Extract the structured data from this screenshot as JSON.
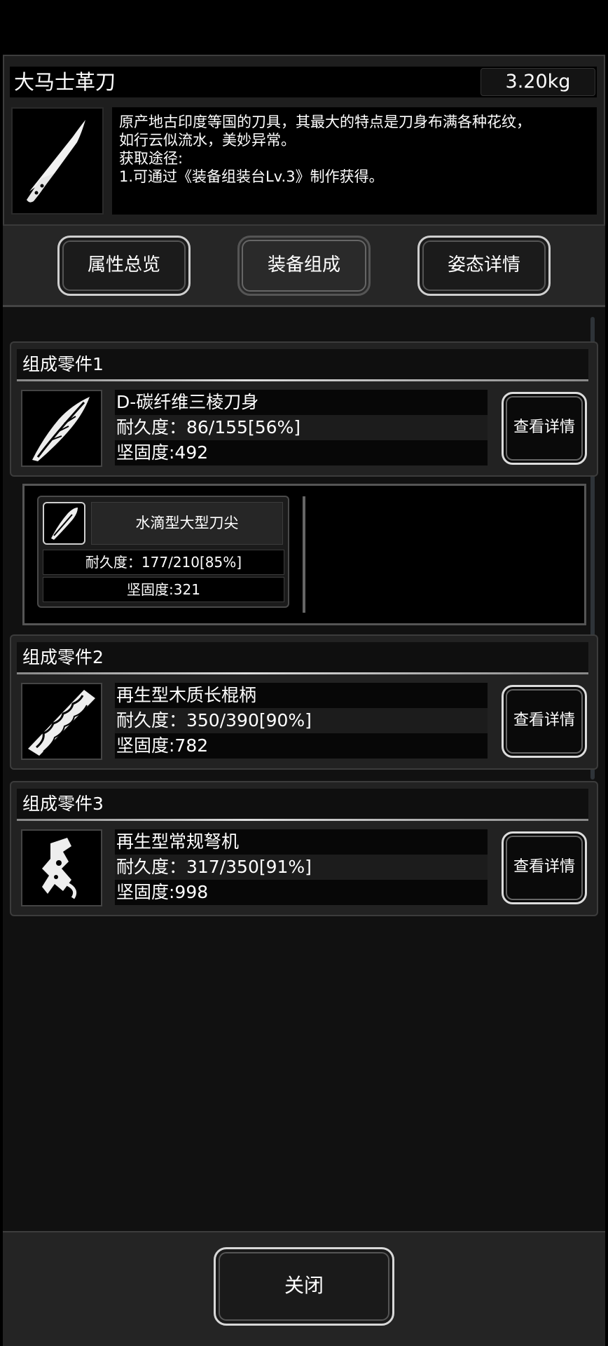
{
  "item": {
    "name": "大马士革刀",
    "weight": "3.20kg",
    "description": [
      "原产地古印度等国的刀具，其最大的特点是刀身布满各种花纹，",
      "如行云似流水，美妙异常。",
      "获取途径:",
      "1.可通过《装备组装台Lv.3》制作获得。"
    ],
    "icon": "knife-icon"
  },
  "tabs": [
    {
      "label": "属性总览",
      "active": false
    },
    {
      "label": "装备组成",
      "active": true
    },
    {
      "label": "姿态详情",
      "active": false
    }
  ],
  "parts": [
    {
      "header": "组成零件1",
      "name": "D-碳纤维三棱刀身",
      "durability": "耐久度：86/155[56%]",
      "hardness": "坚固度:492",
      "button": "查看详情",
      "icon": "feather-blade-icon"
    },
    {
      "header": "组成零件2",
      "name": "再生型木质长棍柄",
      "durability": "耐久度：350/390[90%]",
      "hardness": "坚固度:782",
      "button": "查看详情",
      "icon": "wooden-handle-icon"
    },
    {
      "header": "组成零件3",
      "name": "再生型常规弩机",
      "durability": "耐久度：317/350[91%]",
      "hardness": "坚固度:998",
      "button": "查看详情",
      "icon": "crossbow-mechanism-icon"
    }
  ],
  "subpart": {
    "name": "水滴型大型刀尖",
    "durability": "耐久度：177/210[85%]",
    "hardness": "坚固度:321",
    "icon": "blade-tip-icon"
  },
  "close_label": "关闭"
}
